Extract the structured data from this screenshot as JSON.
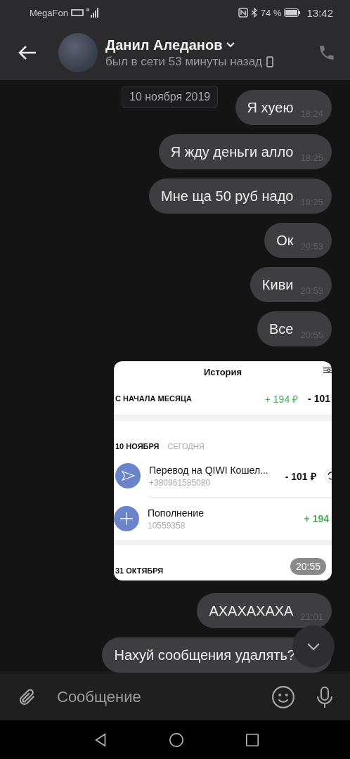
{
  "status_bar": {
    "carrier": "MegaFon",
    "battery": "74 %",
    "time": "13:42"
  },
  "header": {
    "name": "Данил Аледанов",
    "status": "был в сети 53 минуты назад"
  },
  "date_chip": "10 ноября 2019",
  "messages": [
    {
      "kind": "text",
      "text": "Я хуею",
      "time": "18:24"
    },
    {
      "kind": "text",
      "text": "Я жду деньги алло",
      "time": "18:25"
    },
    {
      "kind": "text",
      "text": "Мне ща 50 руб надо",
      "time": "18:25"
    },
    {
      "kind": "text",
      "text": "Ок",
      "time": "20:53"
    },
    {
      "kind": "text",
      "text": "Киви",
      "time": "20:53"
    },
    {
      "kind": "text",
      "text": "Все",
      "time": "20:55"
    },
    {
      "kind": "image",
      "time": "20:55",
      "screenshot": {
        "title": "История",
        "summary": {
          "label": "С НАЧАЛА МЕСЯЦА",
          "income": "+ 194 ₽",
          "expense": "- 101"
        },
        "groups": [
          {
            "date": "10 НОЯБРЯ",
            "note": "СЕГОДНЯ",
            "items": [
              {
                "kind": "transfer",
                "title": "Перевод на QIWI Кошел...",
                "subtitle": "+380961585080",
                "amount": "- 101 ₽",
                "positive": false
              },
              {
                "kind": "topup",
                "title": "Пополнение",
                "subtitle": "10559358",
                "amount": "+ 194",
                "positive": true
              }
            ]
          },
          {
            "date": "31 ОКТЯБРЯ"
          }
        ]
      }
    },
    {
      "kind": "text",
      "text": "АХАХАХАХА",
      "time": "21:01"
    },
    {
      "kind": "text",
      "text": "Нахуй сообщения удалять?"
    }
  ],
  "composer": {
    "placeholder": "Сообщение"
  }
}
